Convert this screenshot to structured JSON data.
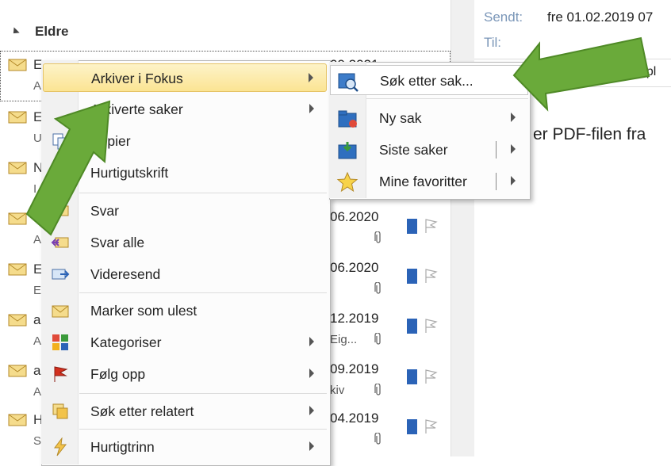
{
  "message_list": {
    "group_header": "Eldre",
    "row_fragments": [
      {
        "letter": "E",
        "sub": "A"
      },
      {
        "letter": "E",
        "sub": "U"
      },
      {
        "letter": "N",
        "sub": "I"
      },
      {
        "letter": "A",
        "sub": "A"
      },
      {
        "letter": "E",
        "sub": "E"
      },
      {
        "letter": "a",
        "sub": "A"
      },
      {
        "letter": "a",
        "sub": "A"
      },
      {
        "letter": "H",
        "sub": "S"
      }
    ],
    "selected_row_date": "09.2021",
    "dates": [
      {
        "date": "06.2020",
        "extra": ""
      },
      {
        "date": "06.2020",
        "extra": ""
      },
      {
        "date": "12.2019",
        "extra": "Eig..."
      },
      {
        "date": "09.2019",
        "extra": "kiv"
      },
      {
        "date": "04.2019",
        "extra": ""
      }
    ]
  },
  "reading_pane": {
    "sent_label": "Sendt:",
    "sent_value": "fre 01.02.2019 07",
    "to_label": "Til:",
    "attachment_name": "rkivpl",
    "body_text": "er PDF-filen fra"
  },
  "context_menu": {
    "items": [
      {
        "label": "Arkiver i Fokus",
        "icon": "none",
        "submenu": true,
        "highlighted": true
      },
      {
        "label": "Arkiverte saker",
        "icon": "none",
        "submenu": true
      },
      {
        "label": "Kopier",
        "icon": "copy-icon",
        "submenu": false
      },
      {
        "label": "Hurtigutskrift",
        "icon": "print-icon",
        "submenu": false
      },
      {
        "label": "Svar",
        "icon": "reply-icon",
        "submenu": false
      },
      {
        "label": "Svar alle",
        "icon": "reply-all-icon",
        "submenu": false
      },
      {
        "label": "Videresend",
        "icon": "forward-icon",
        "submenu": false
      },
      {
        "label": "Marker som ulest",
        "icon": "mark-unread-icon",
        "submenu": false
      },
      {
        "label": "Kategoriser",
        "icon": "categorize-icon",
        "submenu": true
      },
      {
        "label": "Følg opp",
        "icon": "flag-icon",
        "submenu": true
      },
      {
        "label": "Søk etter relatert",
        "icon": "related-search-icon",
        "submenu": true
      },
      {
        "label": "Hurtigtrinn",
        "icon": "quick-steps-icon",
        "submenu": true
      }
    ]
  },
  "submenu": {
    "items": [
      {
        "label": "Søk etter sak...",
        "icon": "search-case-icon",
        "submenu": false
      },
      {
        "label": "Ny sak",
        "icon": "new-case-icon",
        "submenu": true
      },
      {
        "label": "Siste saker",
        "icon": "recent-cases-icon",
        "submenu": true
      },
      {
        "label": "Mine favoritter",
        "icon": "favorites-star-icon",
        "submenu": true
      }
    ]
  },
  "colors": {
    "highlight": "#fbe493",
    "arrow_green": "#6aaa3a",
    "accent_blue": "#2b63b7"
  }
}
